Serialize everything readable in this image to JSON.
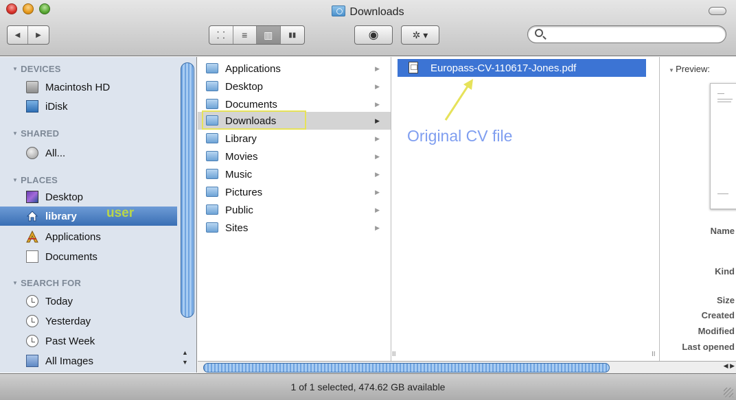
{
  "window": {
    "title": "Downloads"
  },
  "toolbar": {
    "nav": [
      "◀",
      "▶"
    ],
    "views": [
      {
        "icon": "icon-view-icon",
        "glyph": "⸬"
      },
      {
        "icon": "list-view-icon",
        "glyph": "≡"
      },
      {
        "icon": "column-view-icon",
        "glyph": "▥"
      },
      {
        "icon": "coverflow-view-icon",
        "glyph": "▮▮"
      }
    ],
    "active_view": 2,
    "quicklook_glyph": "◉",
    "action_glyph": "✲ ▾",
    "search_placeholder": ""
  },
  "sidebar": {
    "sections": [
      {
        "title": "DEVICES",
        "items": [
          {
            "label": "Macintosh HD",
            "icon": "hard-drive-icon"
          },
          {
            "label": "iDisk",
            "icon": "idisk-icon"
          }
        ]
      },
      {
        "title": "SHARED",
        "items": [
          {
            "label": "All...",
            "icon": "network-globe-icon"
          }
        ]
      },
      {
        "title": "PLACES",
        "items": [
          {
            "label": "Desktop",
            "icon": "desktop-icon"
          },
          {
            "label": "library",
            "icon": "home-icon",
            "selected": true
          },
          {
            "label": "Applications",
            "icon": "applications-icon"
          },
          {
            "label": "Documents",
            "icon": "document-icon"
          }
        ]
      },
      {
        "title": "SEARCH FOR",
        "items": [
          {
            "label": "Today",
            "icon": "clock-icon"
          },
          {
            "label": "Yesterday",
            "icon": "clock-icon"
          },
          {
            "label": "Past Week",
            "icon": "clock-icon"
          },
          {
            "label": "All Images",
            "icon": "images-icon"
          }
        ]
      }
    ],
    "annotation": "user"
  },
  "column1": {
    "items": [
      "Applications",
      "Desktop",
      "Documents",
      "Downloads",
      "Library",
      "Movies",
      "Music",
      "Pictures",
      "Public",
      "Sites"
    ],
    "selected": "Downloads"
  },
  "column2": {
    "file": "Europass-CV-110617-Jones.pdf",
    "annotation": "Original CV file"
  },
  "preview": {
    "label": "Preview:",
    "fields": [
      "Name",
      "Kind",
      "Size",
      "Created",
      "Modified",
      "Last opened"
    ]
  },
  "status": {
    "text": "1 of 1 selected, 474.62 GB available"
  },
  "colors": {
    "selection": "#3c74d4",
    "sidebar": "#dde4ee",
    "highlight_box": "#e6e25a",
    "annotation": "#7f9ef0"
  }
}
